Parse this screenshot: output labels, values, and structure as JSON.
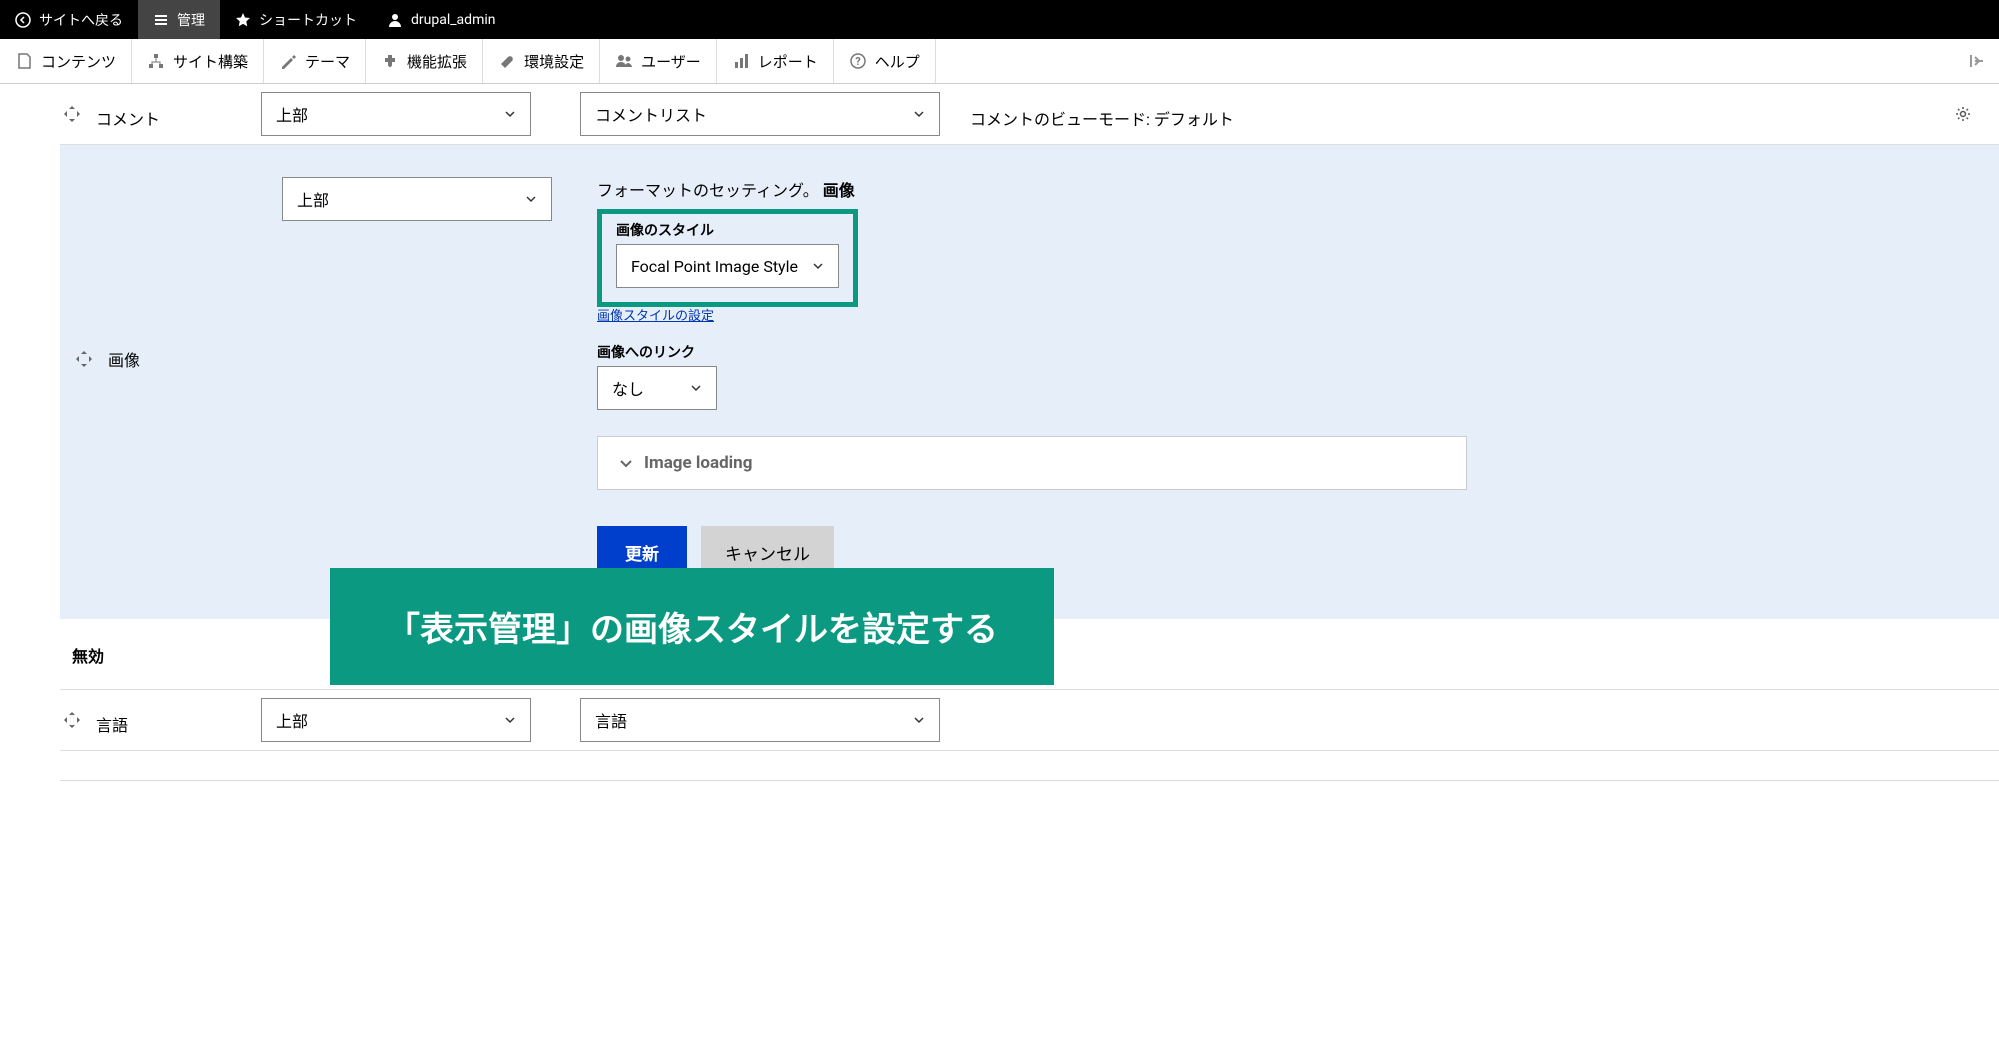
{
  "topbar": {
    "back": "サイトへ戻る",
    "manage": "管理",
    "shortcuts": "ショートカット",
    "user": "drupal_admin"
  },
  "adminMenu": {
    "content": "コンテンツ",
    "structure": "サイト構築",
    "appearance": "テーマ",
    "extend": "機能拡張",
    "config": "環境設定",
    "people": "ユーザー",
    "reports": "レポート",
    "help": "ヘルプ"
  },
  "rows": {
    "comment": {
      "label": "コメント",
      "region": "上部",
      "format": "コメントリスト",
      "summary": "コメントのビューモード: デフォルト"
    },
    "language": {
      "label": "言語",
      "region": "上部",
      "format": "言語"
    }
  },
  "imagePanel": {
    "fieldLabel": "画像",
    "region": "上部",
    "heading": "フォーマットのセッティング。",
    "headingBold": "画像",
    "styleLabel": "画像のスタイル",
    "styleValue": "Focal Point Image Style",
    "styleLink": "画像スタイルの設定",
    "linkLabel": "画像へのリンク",
    "linkValue": "なし",
    "loading": "Image loading",
    "update": "更新",
    "cancel": "キャンセル"
  },
  "disabledHeader": "無効",
  "overlayText": "「表示管理」の画像スタイルを設定する"
}
